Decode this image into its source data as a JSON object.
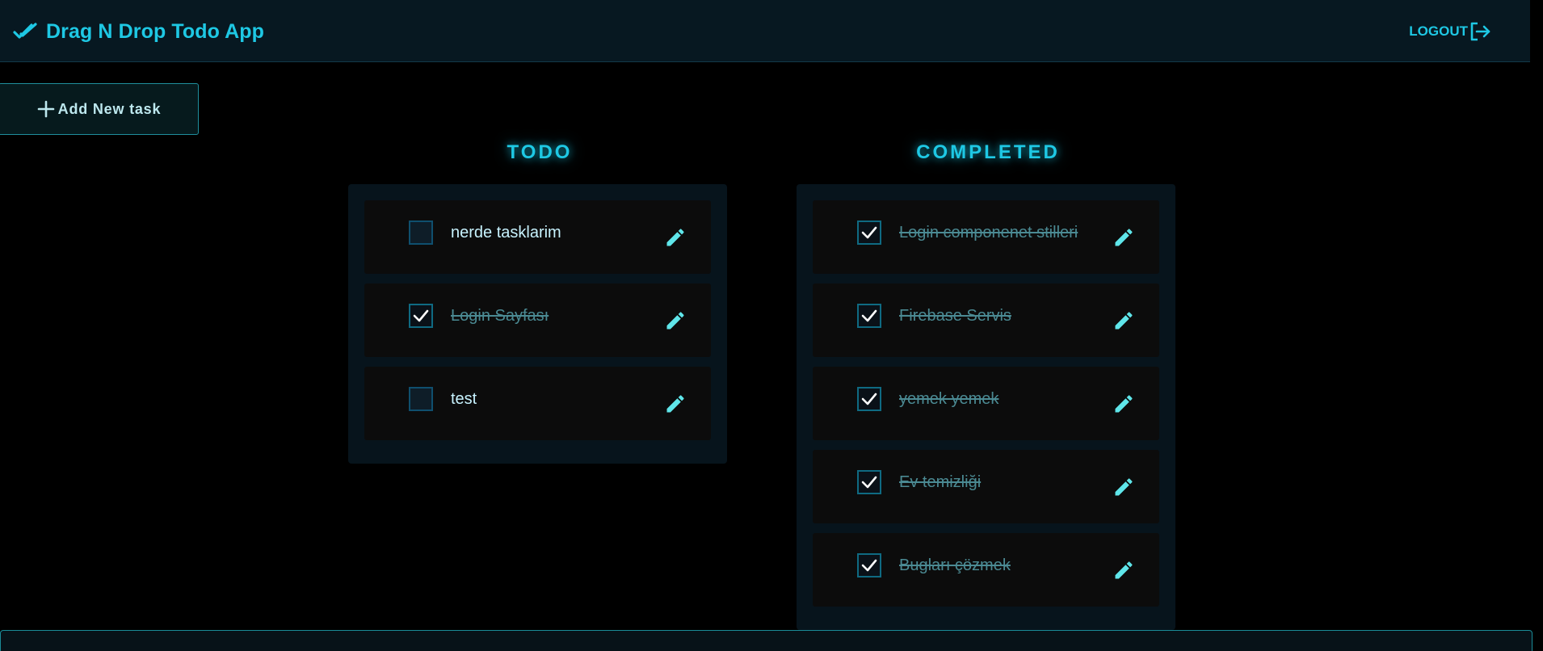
{
  "app": {
    "title": "Drag N Drop Todo App",
    "logout_label": "LOGOUT"
  },
  "actions": {
    "add_task_label": "Add New task"
  },
  "columns": {
    "todo": {
      "title": "TODO",
      "tasks": [
        {
          "text": "nerde tasklarim",
          "completed": false
        },
        {
          "text": "Login Sayfası",
          "completed": true
        },
        {
          "text": "test",
          "completed": false
        }
      ]
    },
    "completed": {
      "title": "COMPLETED",
      "tasks": [
        {
          "text": "Login componenet stilleri",
          "completed": true
        },
        {
          "text": "Firebase Servis",
          "completed": true
        },
        {
          "text": "yemek yemek",
          "completed": true
        },
        {
          "text": "Ev temizliği",
          "completed": true
        },
        {
          "text": "Bugları çözmek",
          "completed": true
        }
      ]
    }
  },
  "icons": {
    "brand": "double-check-icon",
    "logout": "logout-icon",
    "add": "plus-icon",
    "edit": "pencil-icon",
    "checkbox_checked": "check-icon"
  },
  "colors": {
    "accent": "#1ec8e4",
    "app_bar_bg": "#071821",
    "panel_bg": "#07141c",
    "card_bg": "#0c0c0c",
    "done_text": "#4b8a93",
    "pencil": "#5fe6ea"
  }
}
